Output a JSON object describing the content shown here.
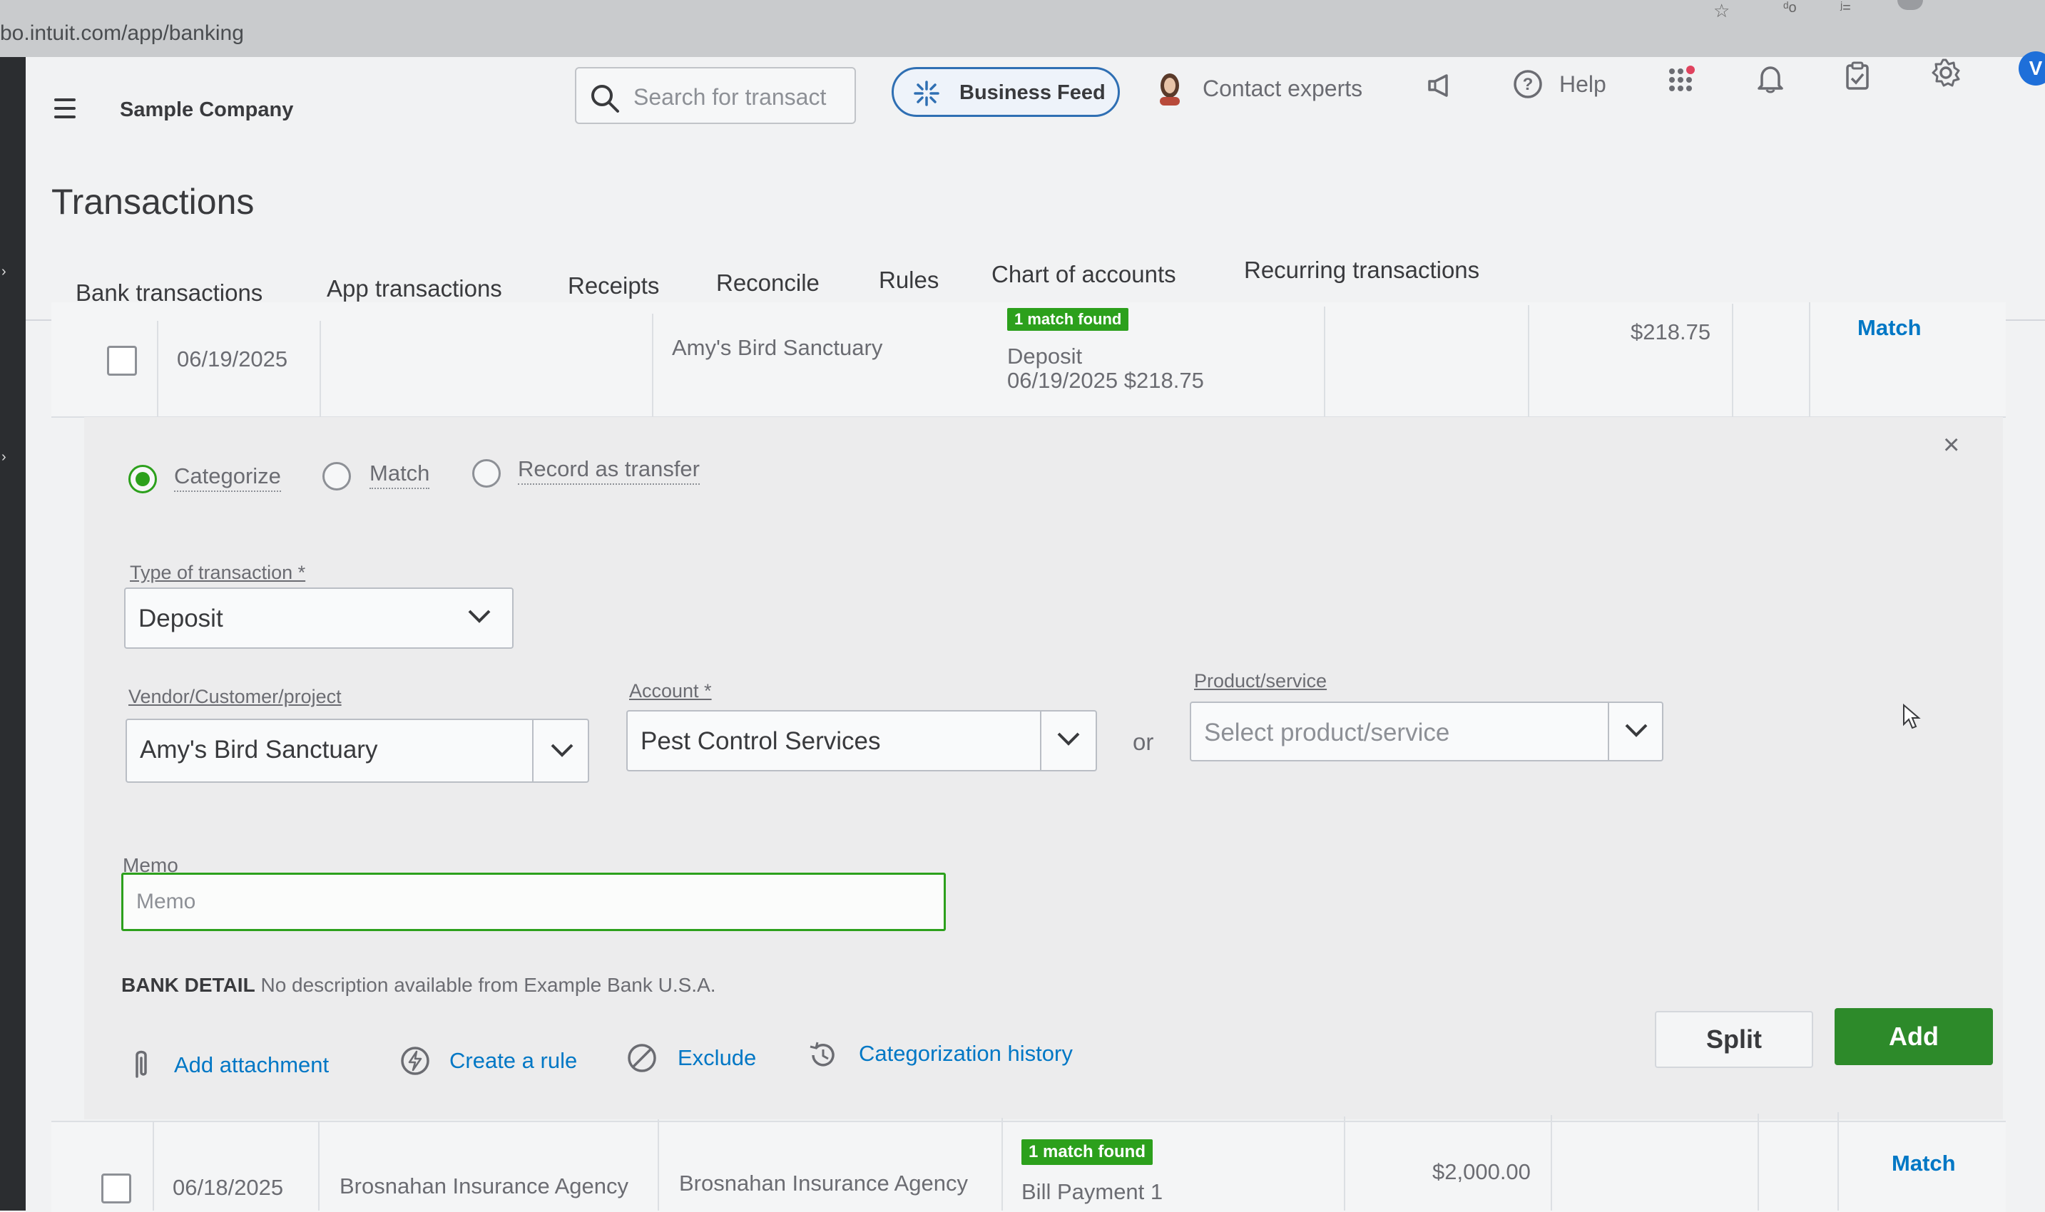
{
  "browser": {
    "url": "bo.intuit.com/app/banking"
  },
  "header": {
    "company": "Sample Company",
    "search_placeholder": "Search for transact",
    "business_feed": "Business Feed",
    "contact_experts": "Contact experts",
    "help": "Help"
  },
  "page": {
    "title": "Transactions"
  },
  "tabs": [
    {
      "label": "Bank transactions",
      "active": true
    },
    {
      "label": "App transactions"
    },
    {
      "label": "Receipts"
    },
    {
      "label": "Reconcile"
    },
    {
      "label": "Rules"
    },
    {
      "label": "Chart of accounts"
    },
    {
      "label": "Recurring transactions"
    }
  ],
  "row1": {
    "date": "06/19/2025",
    "payee": "Amy's Bird Sanctuary",
    "badge": "1 match found",
    "match_type": "Deposit",
    "match_detail": "06/19/2025 $218.75",
    "amount": "$218.75",
    "action": "Match"
  },
  "panel": {
    "radios": [
      "Categorize",
      "Match",
      "Record as transfer"
    ],
    "selected_radio": "Categorize",
    "type_label": "Type of transaction *",
    "type_value": "Deposit",
    "vendor_label": "Vendor/Customer/project",
    "vendor_value": "Amy's Bird Sanctuary",
    "account_label": "Account *",
    "account_value": "Pest Control Services",
    "or": "or",
    "product_label": "Product/service",
    "product_placeholder": "Select product/service",
    "memo_label": "Memo",
    "memo_placeholder": "Memo",
    "bank_detail_label": "BANK DETAIL",
    "bank_detail_text": "No description available from Example Bank U.S.A.",
    "actions": [
      "Add attachment",
      "Create a rule",
      "Exclude",
      "Categorization history"
    ],
    "split": "Split",
    "add": "Add"
  },
  "row2": {
    "date": "06/18/2025",
    "description": "Brosnahan Insurance Agency",
    "payee": "Brosnahan Insurance Agency",
    "badge": "1 match found",
    "match_type": "Bill Payment 1",
    "amount": "$2,000.00",
    "action": "Match"
  },
  "colors": {
    "accent": "#2ca01c",
    "link": "#0077c5",
    "add_button": "#2d8a2a"
  }
}
